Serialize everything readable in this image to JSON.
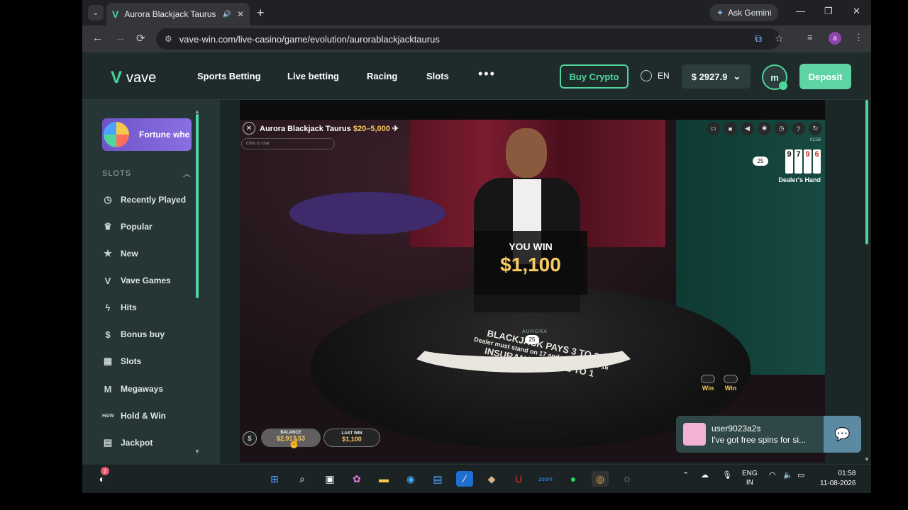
{
  "browser": {
    "tab_title": "Aurora Blackjack Taurus by",
    "url": "vave-win.com/live-casino/game/evolution/aurorablackjacktaurus",
    "gemini_label": "Ask Gemini",
    "profile_letter": "a"
  },
  "header": {
    "logo_text": "vave",
    "nav": [
      "Sports Betting",
      "Live betting",
      "Racing",
      "Slots"
    ],
    "buy_crypto": "Buy Crypto",
    "language": "EN",
    "balance": "$ 2927.9",
    "user_initial": "m",
    "deposit": "Deposit"
  },
  "sidebar": {
    "promo_label": "Fortune whe",
    "section_title": "SLOTS",
    "items": [
      {
        "label": "Recently Played",
        "icon": "clock-icon"
      },
      {
        "label": "Popular",
        "icon": "crown-icon"
      },
      {
        "label": "New",
        "icon": "star-icon"
      },
      {
        "label": "Vave Games",
        "icon": "vave-icon"
      },
      {
        "label": "Hits",
        "icon": "lightning-icon"
      },
      {
        "label": "Bonus buy",
        "icon": "moneybag-icon"
      },
      {
        "label": "Slots",
        "icon": "slot-machine-icon"
      },
      {
        "label": "Megaways",
        "icon": "megaways-icon"
      },
      {
        "label": "Hold & Win",
        "icon": "hold-win-icon"
      },
      {
        "label": "Jackpot",
        "icon": "jackpot-icon"
      }
    ]
  },
  "game": {
    "title": "Aurora Blackjack Taurus",
    "limits": "$20–5,000",
    "chat_placeholder": "Click to chat",
    "time": "01:58",
    "dealer_score": "25",
    "dealer_cards": [
      "9",
      "7",
      "9",
      "6"
    ],
    "dealer_hand_label": "Dealer's Hand",
    "you_win_label": "YOU WIN",
    "win_amount": "$1,100",
    "table_line1": "BLACKJACK PAYS 3 TO 2",
    "table_line2": "Dealer must stand on 17 and must draw to 16",
    "table_line3": "INSURANCE PAYS 2 TO 1",
    "brand_on_table": "AURORA",
    "player_score": "25",
    "win_badges": [
      "Win",
      "Win"
    ],
    "balance_label": "BALANCE",
    "balance_value": "$2,917.53",
    "last_win_label": "LAST WIN",
    "last_win_value": "$1,100"
  },
  "chat_toast": {
    "user": "user9023a2s",
    "message": "I've got free spins for si..."
  },
  "taskbar": {
    "notification_count": "2",
    "lang_line1": "ENG",
    "lang_line2": "IN",
    "time": "01:58",
    "date": "11-08-2026"
  },
  "colors": {
    "accent": "#4fd69c",
    "deposit": "#5ed3a3",
    "gold": "#f5cb62",
    "header_bg": "#1f2b2b",
    "sidebar_bg": "#263535"
  }
}
